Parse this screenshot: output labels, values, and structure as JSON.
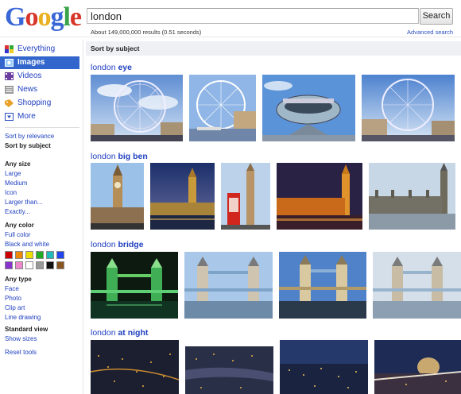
{
  "logo": {
    "letters": [
      "G",
      "o",
      "o",
      "g",
      "l",
      "e"
    ]
  },
  "search": {
    "query": "london",
    "button_label": "Search"
  },
  "stats": {
    "results_text": "About 149,000,000 results (0.51 seconds)",
    "advanced_label": "Advanced search"
  },
  "sidebar": {
    "nav": [
      {
        "label": "Everything",
        "icon": "everything-icon"
      },
      {
        "label": "Images",
        "icon": "images-icon",
        "active": true
      },
      {
        "label": "Videos",
        "icon": "videos-icon"
      },
      {
        "label": "News",
        "icon": "news-icon"
      },
      {
        "label": "Shopping",
        "icon": "shopping-icon"
      },
      {
        "label": "More",
        "icon": "more-icon"
      }
    ],
    "sort": {
      "relevance": "Sort by relevance",
      "subject": "Sort by subject"
    },
    "size": {
      "heading": "Any size",
      "options": [
        "Large",
        "Medium",
        "Icon",
        "Larger than...",
        "Exactly..."
      ]
    },
    "color": {
      "heading": "Any color",
      "full": "Full color",
      "bw": "Black and white",
      "swatches": [
        "#cc0000",
        "#ee8800",
        "#eedd00",
        "#22aa22",
        "#22bbbb",
        "#2244ee",
        "#8833cc",
        "#ee88cc",
        "#ffffff",
        "#999999",
        "#111111",
        "#885522"
      ]
    },
    "type": {
      "heading": "Any type",
      "options": [
        "Face",
        "Photo",
        "Clip art",
        "Line drawing"
      ]
    },
    "view": {
      "heading": "Standard view",
      "sizes": "Show sizes"
    },
    "reset": "Reset tools"
  },
  "sortbar": {
    "label": "Sort by subject"
  },
  "groups": [
    {
      "prefix": "london",
      "subject": "eye"
    },
    {
      "prefix": "london",
      "subject": "big ben"
    },
    {
      "prefix": "london",
      "subject": "bridge"
    },
    {
      "prefix": "london",
      "subject": "at night"
    }
  ]
}
